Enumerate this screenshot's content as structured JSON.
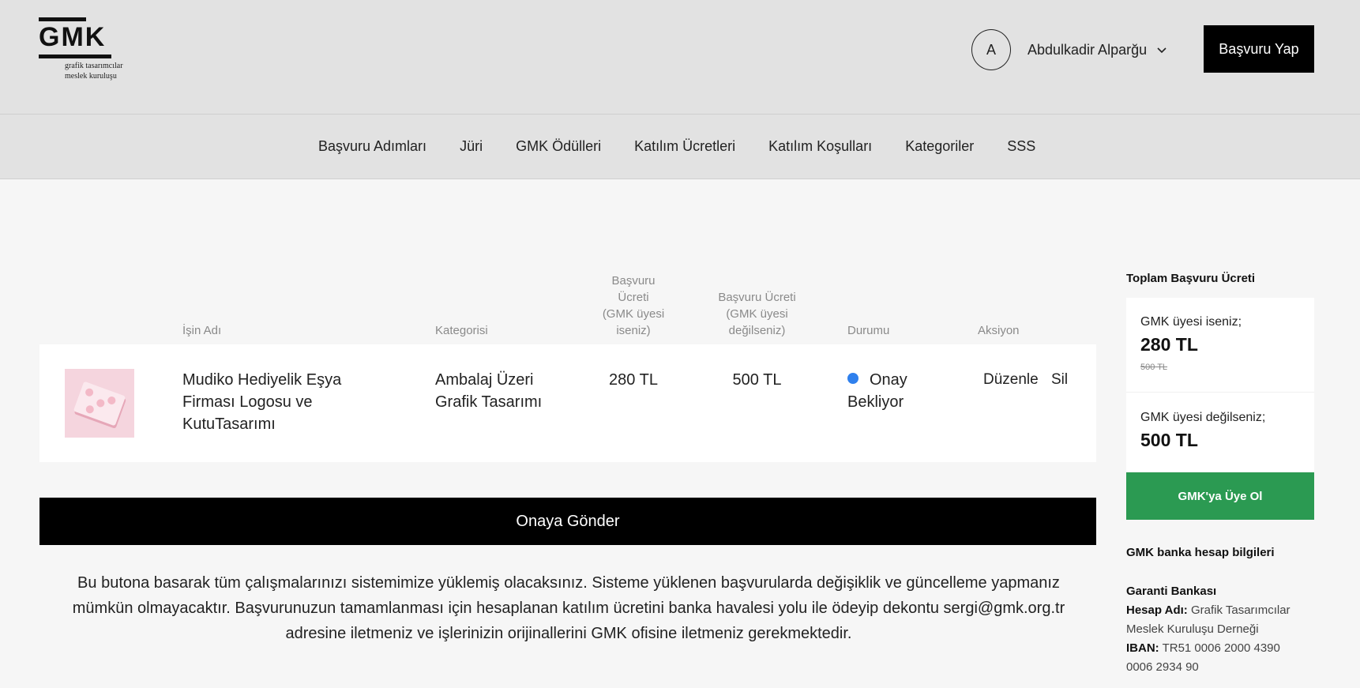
{
  "header": {
    "logo": {
      "word": "GMK",
      "subtitle_line1": "grafik tasarımcılar",
      "subtitle_line2": "meslek kuruluşu"
    },
    "user": {
      "initial": "A",
      "name": "Abdulkadir Alparğu"
    },
    "apply_button": "Başvuru Yap"
  },
  "nav": {
    "items": [
      "Başvuru Adımları",
      "Jüri",
      "GMK Ödülleri",
      "Katılım Ücretleri",
      "Katılım Koşulları",
      "Kategoriler",
      "SSS"
    ]
  },
  "table": {
    "headers": {
      "name": "İşin Adı",
      "category": "Kategorisi",
      "fee_member": [
        "Başvuru",
        "Ücreti",
        "(GMK üyesi",
        "iseniz)"
      ],
      "fee_nonmember": [
        "Başvuru Ücreti",
        "(GMK üyesi",
        "değilseniz)"
      ],
      "status": "Durumu",
      "action": "Aksiyon"
    },
    "rows": [
      {
        "name_lines": [
          "Mudiko Hediyelik Eşya",
          "Firması Logosu ve",
          "KutuTasarımı"
        ],
        "category_lines": [
          "Ambalaj Üzeri",
          "Grafik Tasarımı"
        ],
        "fee_member": "280 TL",
        "fee_nonmember": "500 TL",
        "status_lines": [
          "Onay",
          "Bekliyor"
        ],
        "status_color": "#2f80ed",
        "edit": "Düzenle",
        "delete": "Sil"
      }
    ]
  },
  "submit_button": "Onaya Gönder",
  "info_lines": [
    "Bu butona basarak tüm çalışmalarınızı sistemimize yüklemiş olacaksınız. Sisteme yüklenen başvurularda değişiklik ve güncelleme yapmanız",
    "mümkün olmayacaktır. Başvurunuzun tamamlanması için hesaplanan katılım ücretini banka havalesi yolu ile ödeyip dekontu sergi@gmk.org.tr",
    "adresine iletmeniz ve işlerinizin orijinallerini GMK ofisine iletmeniz gerekmektedir."
  ],
  "sidebar": {
    "title": "Toplam Başvuru Ücreti",
    "member_label": "GMK üyesi iseniz;",
    "member_amount": "280 TL",
    "member_original": "500 TL",
    "nonmember_label": "GMK üyesi değilseniz;",
    "nonmember_amount": "500 TL",
    "join_button": "GMK'ya Üye Ol",
    "join_color": "#2b9a52",
    "bank_title": "GMK banka hesap bilgileri",
    "bank_name": "Garanti Bankası",
    "account_label": "Hesap Adı:",
    "account_value_1": "Grafik Tasarımcılar",
    "account_value_2": "Meslek Kuruluşu Derneği",
    "iban_label": "IBAN:",
    "iban_value_1": "TR51 0006 2000 4390",
    "iban_value_2": "0006 2934 90"
  }
}
